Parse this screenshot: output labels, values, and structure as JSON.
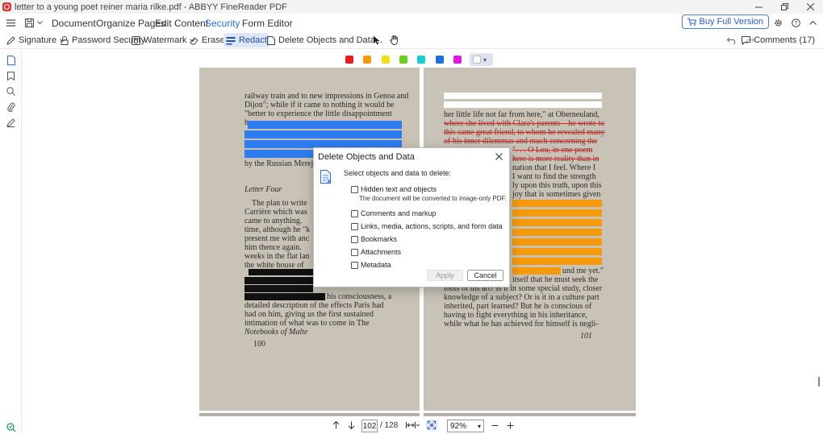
{
  "window": {
    "title": "letter to a young poet reiner maria rilke.pdf - ABBYY FineReader PDF",
    "controls": [
      "minimize-icon",
      "restore-icon",
      "close-icon"
    ]
  },
  "menu": {
    "tabs": [
      "Document",
      "Organize Pages",
      "Edit Content",
      "Security",
      "Form Editor"
    ],
    "active_tab": "Security",
    "buy_label": "Buy Full Version"
  },
  "toolbar": {
    "signature": "Signature",
    "password_security": "Password Security",
    "watermark": "Watermark",
    "erase": "Erase",
    "redact": "Redact",
    "delete_objects": "Delete Objects and Data...",
    "comments": "Comments (17)"
  },
  "colors": {
    "swatches": [
      "#e61e1e",
      "#f59a0a",
      "#f0e010",
      "#6ad01c",
      "#18d0d0",
      "#1c70e0",
      "#e018e0",
      "#ffffff"
    ],
    "accent": "#2a6fd6",
    "redact_blue": "#2e7cf0",
    "highlight_orange": "#f59a0a"
  },
  "document": {
    "left_page": {
      "lines": [
        "railway train and to new impressions in Genoa and",
        "Dijon\"; while if it came to nothing it would be",
        "\"better to experience the little disappointment",
        "h",
        "by the Russian Merej",
        "Letter Four",
        "The plan to write",
        "Carrière which was",
        "came to anything.",
        "time, although he \"k",
        "present me with anc",
        "him thence again.",
        "weeks in the flat lan",
        "the white house of",
        "his consciousness, a",
        "detailed description of the effects Paris had",
        "had on him, giving us the first sustained",
        "intimation of what was to come in The",
        "Notebooks of Malte"
      ],
      "page_number": "100"
    },
    "right_page": {
      "lines": [
        "her little life not far from here,\" at Oberneuland,",
        "where she lived with Clara's parents—he wrote to",
        "this same great friend, to whom he revealed many",
        "of his inner dilemmas and much concerning the",
        "\". . . O Lou, in one poem",
        "here is more reality than in",
        "nation that I feel. Where I",
        "I want to find the strength",
        "ly upon this truth, upon this",
        "joy that is sometimes given",
        "und me yet.\"",
        "itself that he must seek the",
        "tools of his art? Is it in some special study, closer",
        "knowledge of a subject? Or is it in a culture part",
        "inherited, part learned? But he is conscious of",
        "having to fight everything in his inheritance,",
        "while what he has achieved for himself is negli-"
      ],
      "page_number": "101"
    }
  },
  "navigation": {
    "current_page": "102",
    "total_pages": "/ 128",
    "zoom": "92%"
  },
  "dialog": {
    "title": "Delete Objects and Data",
    "prompt": "Select objects and data to delete:",
    "options": [
      {
        "label": "Hidden text and objects",
        "checked": false
      },
      {
        "label": "Comments and markup",
        "checked": false
      },
      {
        "label": "Links, media, actions, scripts, and form data",
        "checked": false
      },
      {
        "label": "Bookmarks",
        "checked": false
      },
      {
        "label": "Attachments",
        "checked": false
      },
      {
        "label": "Metadata",
        "checked": false
      }
    ],
    "hidden_text_note": "The document will be converted to image-only PDF.",
    "apply_label": "Apply",
    "cancel_label": "Cancel"
  }
}
